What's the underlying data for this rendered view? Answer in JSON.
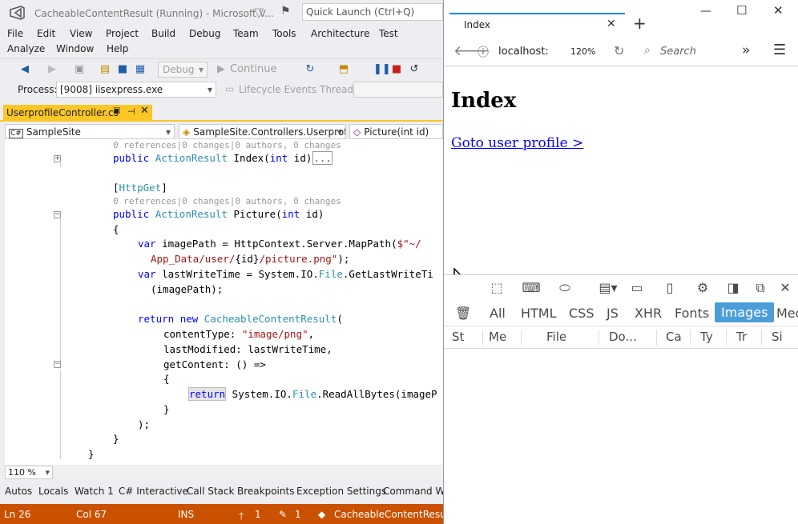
{
  "vs": {
    "title": "CacheableContentResult (Running) - Microsoft V...",
    "quick_launch_placeholder": "Quick Launch (Ctrl+Q)",
    "menu_row1": [
      "File",
      "Edit",
      "View",
      "Project",
      "Build",
      "Debug",
      "Team",
      "Tools",
      "Architecture",
      "Test"
    ],
    "menu_row2": [
      "Analyze",
      "Window",
      "Help"
    ],
    "toolbar": {
      "config": "Debug",
      "continue_label": "Continue"
    },
    "debugbar": {
      "process_label": "Process:",
      "process_value": "[9008] iisexpress.exe",
      "lifecycle_label": "Lifecycle Events",
      "thread_label": "Thread:"
    },
    "doc_tab": {
      "label": "UserprofileController.cs"
    },
    "nav": {
      "project": "SampleSite",
      "class": "SampleSite.Controllers.Userprofile",
      "member": "Picture(int id)"
    },
    "code": {
      "lens1": "0 references|0 changes|0 authors, 0 changes",
      "line_index": [
        "public ",
        "ActionResult",
        " Index(",
        "int",
        " id)"
      ],
      "collapsed": "...",
      "attr_open": "[",
      "attr_name": "HttpGet",
      "attr_close": "]",
      "lens2": "0 references|0 changes|0 authors, 0 changes",
      "line_picture": [
        "public ",
        "ActionResult",
        " Picture(",
        "int",
        " id)"
      ],
      "brace_open": "{",
      "l_var1a": [
        "var",
        " imagePath = HttpContext.Server.MapPath(",
        "$\"~/"
      ],
      "l_var1b": [
        "App_Data/user/",
        "{id}",
        "/picture.png\"",
        ");"
      ],
      "l_var2a": [
        "var",
        " lastWriteTime = System.IO.",
        "File",
        ".GetLastWriteTi"
      ],
      "l_var2b": "(imagePath);",
      "l_ret": [
        "return",
        " ",
        "new",
        " ",
        "CacheableContentResult",
        "("
      ],
      "l_ct": [
        "contentType: ",
        "\"image/png\"",
        ","
      ],
      "l_lm": "lastModified: lastWriteTime,",
      "l_gc": "getContent: () =>",
      "l_brace2": "{",
      "l_inner": [
        "return",
        " System.IO.",
        "File",
        ".ReadAllBytes(imageP"
      ],
      "l_brace3": "}",
      "l_close_call": ");",
      "l_brace4": "}",
      "l_brace5": "}"
    },
    "zoom": "110 %",
    "tool_tabs": [
      "Autos",
      "Locals",
      "Watch 1",
      "C# Interactive",
      "Call Stack",
      "Breakpoints",
      "Exception Settings",
      "Command Wi"
    ],
    "status": {
      "ln": "Ln 26",
      "col": "Col 67",
      "ins": "INS",
      "up": "1",
      "pencil": "1",
      "project": "CacheableContentResult"
    }
  },
  "browser": {
    "tab_title": "Index",
    "url": "localhost:",
    "zoom": "120%",
    "search_placeholder": "Search",
    "page": {
      "heading": "Index",
      "link": "Goto user profile >"
    },
    "devtools": {
      "filters": [
        "All",
        "HTML",
        "CSS",
        "JS",
        "XHR",
        "Fonts",
        "Images",
        "Med"
      ],
      "active_filter": "Images",
      "columns": [
        "St",
        "Me",
        "File",
        "Do...",
        "Ca",
        "Ty",
        "Tr",
        "Si"
      ]
    }
  },
  "colors": {
    "vs_accent": "#ca5100",
    "tab_active": "#fcc624",
    "devtools_active": "#4c9ed9",
    "link": "#0000ee"
  }
}
